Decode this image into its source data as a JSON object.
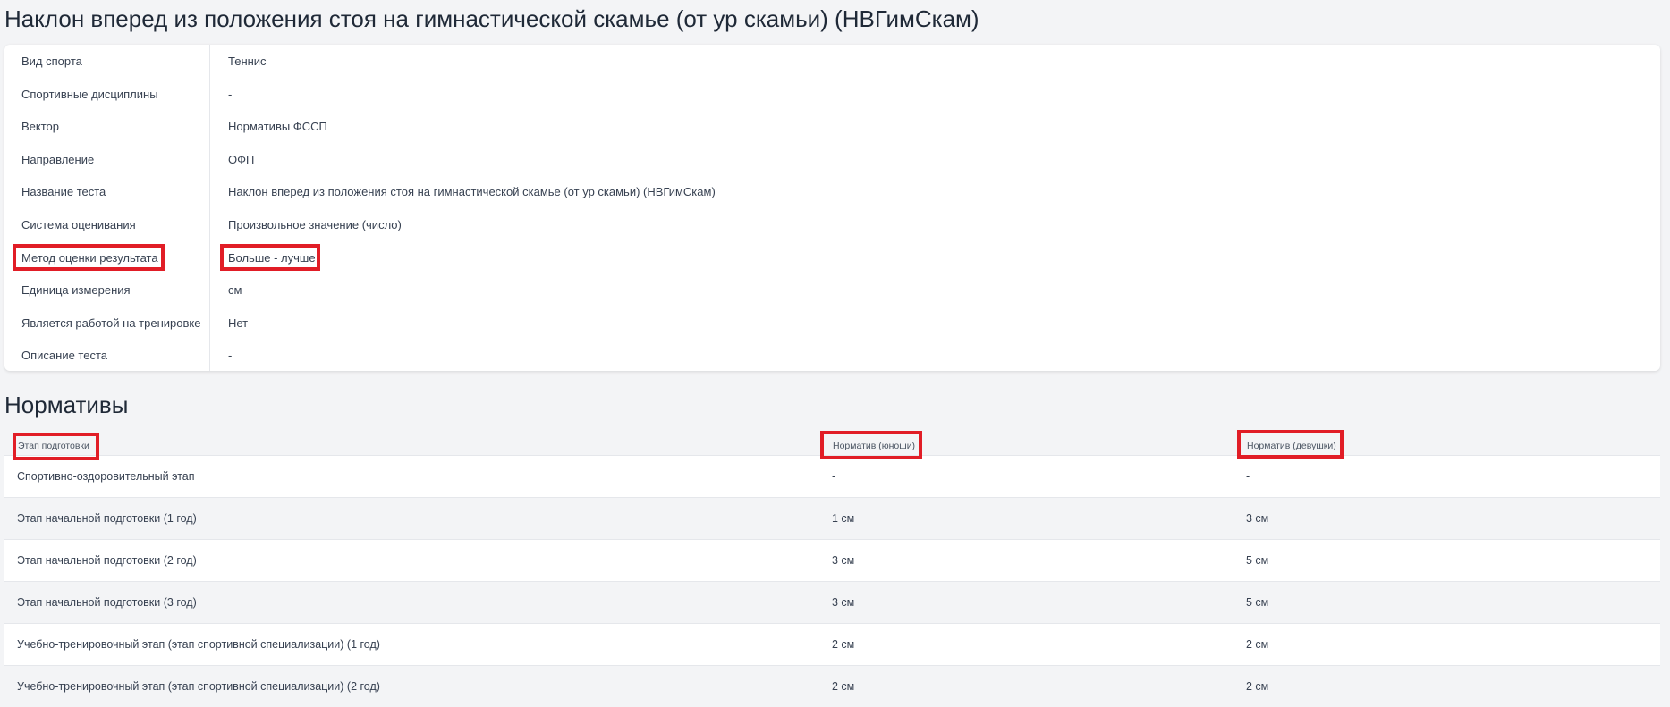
{
  "page": {
    "title": "Наклон вперед из положения стоя на гимнастической скамье (от ур скамьи) (НВГимСкам)"
  },
  "details": [
    {
      "label": "Вид спорта",
      "value": "Теннис"
    },
    {
      "label": "Спортивные дисциплины",
      "value": "-"
    },
    {
      "label": "Вектор",
      "value": "Нормативы ФССП"
    },
    {
      "label": "Направление",
      "value": "ОФП"
    },
    {
      "label": "Название теста",
      "value": "Наклон вперед из положения стоя на гимнастической скамье (от ур скамьи) (НВГимСкам)"
    },
    {
      "label": "Система оценивания",
      "value": "Произвольное значение (число)"
    },
    {
      "label": "Метод оценки результата",
      "value": "Больше - лучше"
    },
    {
      "label": "Единица измерения",
      "value": "см"
    },
    {
      "label": "Является работой на тренировке",
      "value": "Нет"
    },
    {
      "label": "Описание теста",
      "value": "-"
    }
  ],
  "norms": {
    "title": "Нормативы",
    "columns": [
      "Этап подготовки",
      "Норматив (юноши)",
      "Норматив (девушки)"
    ],
    "rows": [
      [
        "Спортивно-оздоровительный этап",
        "-",
        "-"
      ],
      [
        "Этап начальной подготовки (1 год)",
        "1 см",
        "3 см"
      ],
      [
        "Этап начальной подготовки (2 год)",
        "3 см",
        "5 см"
      ],
      [
        "Этап начальной подготовки (3 год)",
        "3 см",
        "5 см"
      ],
      [
        "Учебно-тренировочный этап (этап спортивной специализации) (1 год)",
        "2 см",
        "2 см"
      ],
      [
        "Учебно-тренировочный этап (этап спортивной специализации) (2 год)",
        "2 см",
        "2 см"
      ]
    ]
  },
  "colors": {
    "highlight": "#e11d26",
    "background": "#f3f4f6",
    "card": "#ffffff"
  }
}
